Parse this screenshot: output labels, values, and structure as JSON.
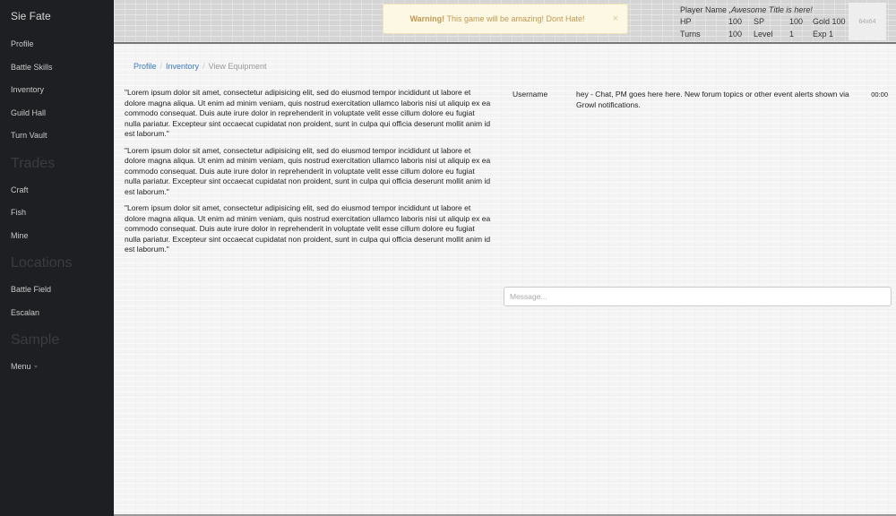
{
  "sidebar": {
    "brand": "Sie Fate",
    "items_main": [
      "Profile",
      "Battle Skills",
      "Inventory",
      "Guild Hall",
      "Turn Vault"
    ],
    "header_trades": "Trades",
    "items_trades": [
      "Craft",
      "Fish",
      "Mine"
    ],
    "header_locations": "Locations",
    "items_locations": [
      "Battle Field",
      "Escalan"
    ],
    "header_sample": "Sample",
    "menu_label": "Menu"
  },
  "alert": {
    "strong": "Warning!",
    "text": " This game will be amazing! Dont Hate!",
    "close": "×"
  },
  "player": {
    "name_label": "Player Name",
    "title": ",Awesome Title is here!",
    "hp_label": "HP",
    "hp": "100",
    "sp_label": "SP",
    "sp": "100",
    "gold_label": "Gold",
    "gold": "100",
    "turns_label": "Turns",
    "turns": "100",
    "level_label": "Level",
    "level": "1",
    "exp_label": "Exp",
    "exp": "1",
    "avatar_text": "64x64"
  },
  "breadcrumb": {
    "profile": "Profile",
    "inventory": "Inventory",
    "current": "View Equipment",
    "sep": "/"
  },
  "content": {
    "paragraphs": [
      "\"Lorem ipsum dolor sit amet, consectetur adipisicing elit, sed do eiusmod tempor incididunt ut labore et dolore magna aliqua. Ut enim ad minim veniam, quis nostrud exercitation ullamco laboris nisi ut aliquip ex ea commodo consequat. Duis aute irure dolor in reprehenderit in voluptate velit esse cillum dolore eu fugiat nulla pariatur. Excepteur sint occaecat cupidatat non proident, sunt in culpa qui officia deserunt mollit anim id est laborum.\"",
      "\"Lorem ipsum dolor sit amet, consectetur adipisicing elit, sed do eiusmod tempor incididunt ut labore et dolore magna aliqua. Ut enim ad minim veniam, quis nostrud exercitation ullamco laboris nisi ut aliquip ex ea commodo consequat. Duis aute irure dolor in reprehenderit in voluptate velit esse cillum dolore eu fugiat nulla pariatur. Excepteur sint occaecat cupidatat non proident, sunt in culpa qui officia deserunt mollit anim id est laborum.\"",
      "\"Lorem ipsum dolor sit amet, consectetur adipisicing elit, sed do eiusmod tempor incididunt ut labore et dolore magna aliqua. Ut enim ad minim veniam, quis nostrud exercitation ullamco laboris nisi ut aliquip ex ea commodo consequat. Duis aute irure dolor in reprehenderit in voluptate velit esse cillum dolore eu fugiat nulla pariatur. Excepteur sint occaecat cupidatat non proident, sunt in culpa qui officia deserunt mollit anim id est laborum.\""
    ]
  },
  "chat": {
    "username": "Username",
    "message": "hey - Chat, PM goes here here. New forum topics or other event alerts shown via Growl notifications.",
    "time": "00:00",
    "input_placeholder": "Message..."
  }
}
